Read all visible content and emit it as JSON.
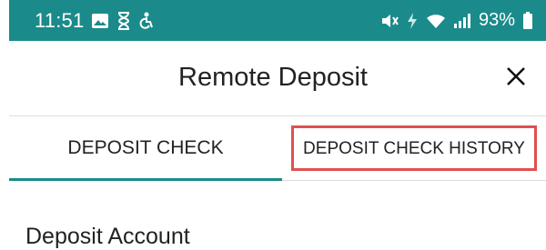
{
  "status_bar": {
    "time": "11:51",
    "battery": "93%",
    "background": "#1b8a8a",
    "left_icons": [
      "image-icon",
      "hourglass-icon",
      "accessibility-icon"
    ],
    "right_icons": [
      "mute-icon",
      "charging-icon",
      "wifi-icon",
      "signal-icon",
      "battery-icon"
    ]
  },
  "header": {
    "title": "Remote Deposit",
    "close_icon": "close-icon"
  },
  "tabs": [
    {
      "label": "DEPOSIT CHECK",
      "selected": true
    },
    {
      "label": "DEPOSIT CHECK HISTORY",
      "selected": false,
      "highlight_color": "#e05050"
    }
  ],
  "content": {
    "section_label": "Deposit Account"
  },
  "colors": {
    "accent": "#1b8a8a",
    "highlight": "#e05050"
  }
}
